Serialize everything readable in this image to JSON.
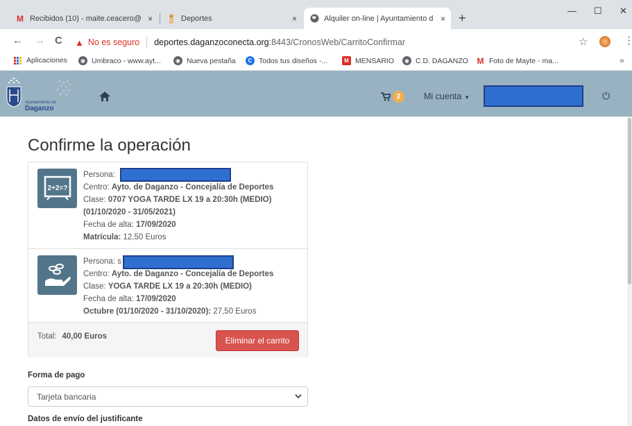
{
  "browser": {
    "tabs": [
      {
        "title": "Recibidos (10) - maite.ceacero@",
        "icon": "gmail-icon"
      },
      {
        "title": "Deportes",
        "icon": "deportes-favicon"
      },
      {
        "title": "Alquiler on-line | Ayuntamiento d",
        "icon": "globe-icon",
        "active": true
      }
    ],
    "close_glyph": "×",
    "new_tab_glyph": "+",
    "window_controls": {
      "minimize": "—",
      "maximize": "☐",
      "close": "✕"
    },
    "nav": {
      "back": "←",
      "forward": "→",
      "reload": "C"
    },
    "security_text": "No es seguro",
    "url_host": "deportes.daganzoconecta.org",
    "url_rest": ":8443/CronosWeb/CarritoConfirmar",
    "bookmarks": [
      {
        "label": "Aplicaciones",
        "icon": "apps-icon"
      },
      {
        "label": "Umbraco - www.ayt...",
        "icon": "globe-icon"
      },
      {
        "label": "Nueva pestaña",
        "icon": "globe-icon"
      },
      {
        "label": "Todos tus diseños -...",
        "icon": "canva-icon"
      },
      {
        "label": "MENSARIO",
        "icon": "mensario-icon"
      },
      {
        "label": "C.D. DAGANZO",
        "icon": "globe-icon"
      },
      {
        "label": "Foto de Mayte - ma...",
        "icon": "gmail-icon"
      }
    ],
    "bookmarks_more": "»"
  },
  "header": {
    "logo_text": {
      "line1": "Ayuntamiento de",
      "line2": "Daganzo"
    },
    "cart_count": "2",
    "account_label": "Mi cuenta"
  },
  "page": {
    "title": "Confirme la operación",
    "items": [
      {
        "icon": "math-board-icon",
        "icon_text": "2+2=?",
        "persona_label": "Persona:",
        "centro_label": "Centro:",
        "centro_value": "Ayto. de Daganzo - Concejalía de Deportes",
        "clase_label": "Clase:",
        "clase_value_line1": "0707 YOGA TARDE LX 19 a 20:30h (MEDIO)",
        "clase_value_line2": "(01/10/2020 - 31/05/2021)",
        "fecha_label": "Fecha de alta:",
        "fecha_value": "17/09/2020",
        "extra_label": "Matrícula:",
        "extra_value": "12,50 Euros"
      },
      {
        "icon": "hand-coins-icon",
        "persona_label": "Persona:",
        "persona_fragment": "s",
        "centro_label": "Centro:",
        "centro_value": "Ayto. de Daganzo - Concejalía de Deportes",
        "clase_label": "Clase:",
        "clase_value": "YOGA TARDE LX 19 a 20:30h (MEDIO)",
        "fecha_label": "Fecha de alta:",
        "fecha_value": "17/09/2020",
        "extra_label": "Octubre (01/10/2020 - 31/10/2020):",
        "extra_value": "27,50 Euros"
      }
    ],
    "total_label": "Total:",
    "total_value": "40,00 Euros",
    "remove_cart_button": "Eliminar el carrito",
    "payment_label": "Forma de pago",
    "payment_selected": "Tarjeta bancaria",
    "shipping_label": "Datos de envío del justificante"
  },
  "colors": {
    "header_bg": "#99b2c1",
    "danger": "#d9534f",
    "badge": "#f0ad4e",
    "icon_tile": "#53758a",
    "redaction": "#2f6fcf"
  }
}
